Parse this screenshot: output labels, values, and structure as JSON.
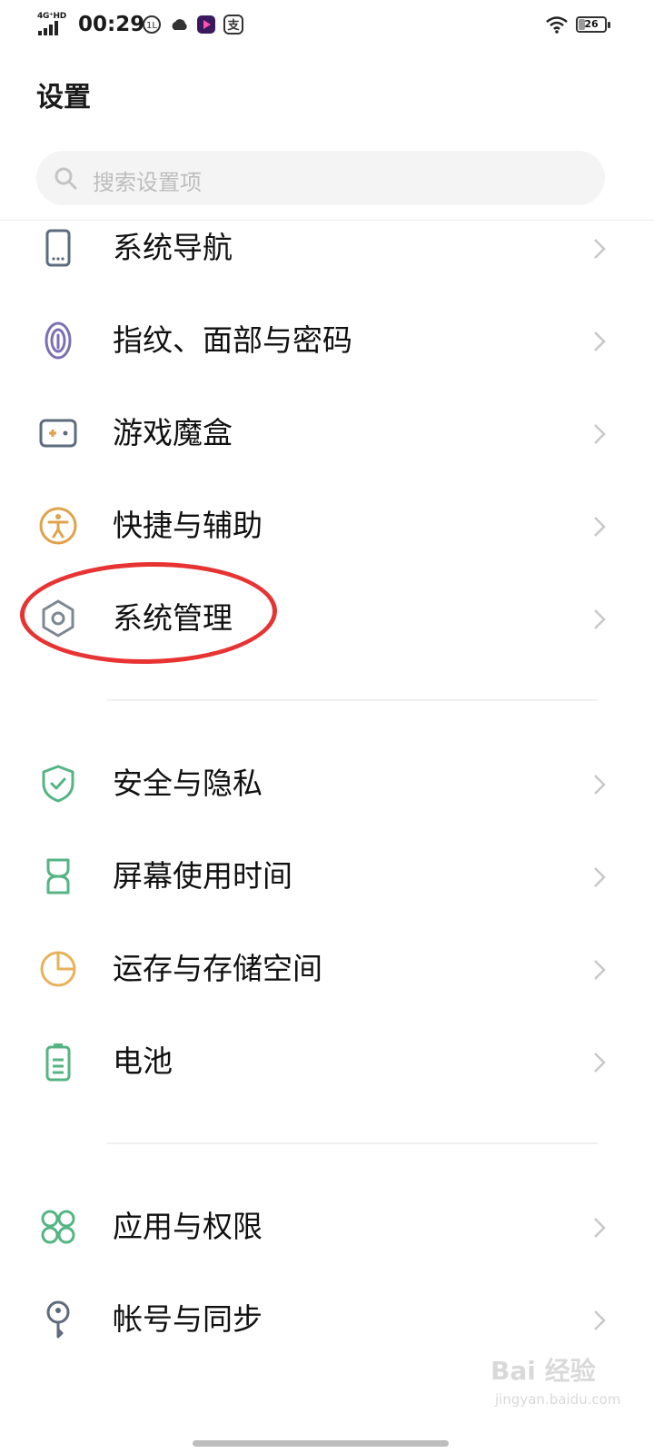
{
  "status_bar": {
    "network": "4G⁺HD",
    "time": "00:29",
    "battery_level": "26",
    "battery_fraction": 0.26
  },
  "page_title": "设置",
  "search": {
    "placeholder": "搜索设置项"
  },
  "groups": [
    {
      "items": [
        {
          "label": "系统导航",
          "icon": "phone-navigation-icon",
          "color": "#5d6b7d"
        },
        {
          "label": "指纹、面部与密码",
          "icon": "fingerprint-icon",
          "color": "#7c6fb3"
        },
        {
          "label": "游戏魔盒",
          "icon": "gamepad-icon",
          "color": "#5d6b7d"
        },
        {
          "label": "快捷与辅助",
          "icon": "accessibility-icon",
          "color": "#e0a24a"
        },
        {
          "label": "系统管理",
          "icon": "hexagon-settings-icon",
          "color": "#7d8794"
        }
      ]
    },
    {
      "items": [
        {
          "label": "安全与隐私",
          "icon": "shield-check-icon",
          "color": "#55b484"
        },
        {
          "label": "屏幕使用时间",
          "icon": "hourglass-icon",
          "color": "#55b484"
        },
        {
          "label": "运存与存储空间",
          "icon": "pie-chart-icon",
          "color": "#e7b25a"
        },
        {
          "label": "电池",
          "icon": "battery-icon",
          "color": "#55b484"
        }
      ]
    },
    {
      "items": [
        {
          "label": "应用与权限",
          "icon": "apps-grid-icon",
          "color": "#55b484"
        },
        {
          "label": "帐号与同步",
          "icon": "key-icon",
          "color": "#5d6b7d"
        }
      ]
    }
  ],
  "annotation": {
    "color": "#e83333",
    "target": "系统管理"
  },
  "watermark": {
    "text": "Bai 经验",
    "sub": "jingyan.baidu.com"
  }
}
